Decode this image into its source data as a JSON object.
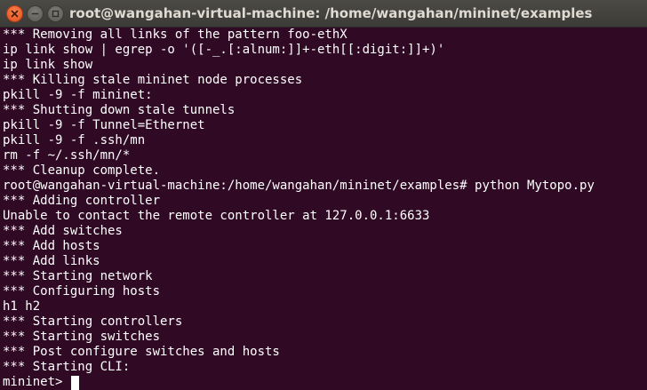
{
  "window": {
    "title": "root@wangahan-virtual-machine: /home/wangahan/mininet/examples"
  },
  "icons": {
    "close": "close-icon",
    "minimize": "minimize-icon",
    "maximize": "maximize-icon"
  },
  "colors": {
    "terminal_background": "#300a24",
    "terminal_text": "#ffffff",
    "close_button": "#e95420",
    "titlebar": "#3c3b37"
  },
  "terminal": {
    "lines": [
      "*** Removing all links of the pattern foo-ethX",
      "ip link show | egrep -o '([-_.[:alnum:]]+-eth[[:digit:]]+)'",
      "ip link show",
      "*** Killing stale mininet node processes",
      "pkill -9 -f mininet:",
      "*** Shutting down stale tunnels",
      "pkill -9 -f Tunnel=Ethernet",
      "pkill -9 -f .ssh/mn",
      "rm -f ~/.ssh/mn/*",
      "*** Cleanup complete.",
      "root@wangahan-virtual-machine:/home/wangahan/mininet/examples# python Mytopo.py",
      "*** Adding controller",
      "Unable to contact the remote controller at 127.0.0.1:6633",
      "*** Add switches",
      "*** Add hosts",
      "*** Add links",
      "*** Starting network",
      "*** Configuring hosts",
      "h1 h2",
      "*** Starting controllers",
      "*** Starting switches",
      "*** Post configure switches and hosts",
      "*** Starting CLI:"
    ],
    "prompt": "mininet> "
  }
}
